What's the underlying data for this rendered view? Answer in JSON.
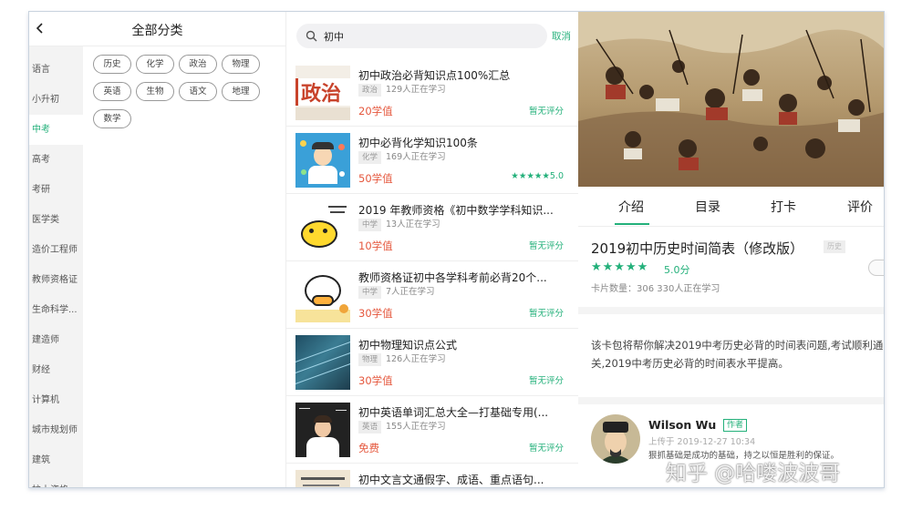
{
  "category_panel": {
    "title": "全部分类",
    "sidebar": [
      "语言",
      "小升初",
      "中考",
      "高考",
      "考研",
      "医学类",
      "造价工程师",
      "教师资格证",
      "生命科学...",
      "建造师",
      "财经",
      "计算机",
      "城市规划师",
      "建筑",
      "护士资格..."
    ],
    "active_index": 2,
    "tags": [
      "历史",
      "化学",
      "政治",
      "物理",
      "英语",
      "生物",
      "语文",
      "地理",
      "数学"
    ]
  },
  "search": {
    "value": "初中",
    "cancel_label": "取消"
  },
  "results": [
    {
      "title": "初中政治必背知识点100%汇总",
      "subject": "政治",
      "learners": "129人正在学习",
      "price": "20学值",
      "rating": "暂无评分"
    },
    {
      "title": "初中必背化学知识100条",
      "subject": "化学",
      "learners": "169人正在学习",
      "price": "50学值",
      "rating": "★★★★★5.0"
    },
    {
      "title": "2019 年教师资格《初中数学学科知识...",
      "subject": "中学",
      "learners": "13人正在学习",
      "price": "10学值",
      "rating": "暂无评分"
    },
    {
      "title": "教师资格证初中各学科考前必背20个...",
      "subject": "中学",
      "learners": "7人正在学习",
      "price": "30学值",
      "rating": "暂无评分"
    },
    {
      "title": "初中物理知识点公式",
      "subject": "物理",
      "learners": "126人正在学习",
      "price": "30学值",
      "rating": "暂无评分"
    },
    {
      "title": "初中英语单词汇总大全—打基础专用(...",
      "subject": "英语",
      "learners": "155人正在学习",
      "price": "免费",
      "rating": "暂无评分"
    },
    {
      "title": "初中文言文通假字、成语、重点语句..."
    }
  ],
  "thumb_texts": {
    "politics": "政治"
  },
  "detail": {
    "tabs": [
      "介绍",
      "目录",
      "打卡",
      "评价"
    ],
    "active_tab": 0,
    "title": "2019初中历史时间简表（修改版）",
    "subject": "历史",
    "stars": "★★★★★",
    "score": "5.0分",
    "meta": "卡片数量：306  330人正在学习",
    "description": "该卡包将帮你解决2019中考历史必背的时间表问题,考试顺利通关,2019中考历史必背的时间表水平提高。",
    "author": {
      "name": "Wilson Wu",
      "role": "作者",
      "date": "上传于 2019-12-27 10:34",
      "motto": "狠抓基础是成功的基础，持之以恒是胜利的保证。"
    }
  },
  "watermark": "知乎 @哈喽波波哥",
  "colors": {
    "accent": "#23b07a",
    "price": "#e5583e"
  }
}
